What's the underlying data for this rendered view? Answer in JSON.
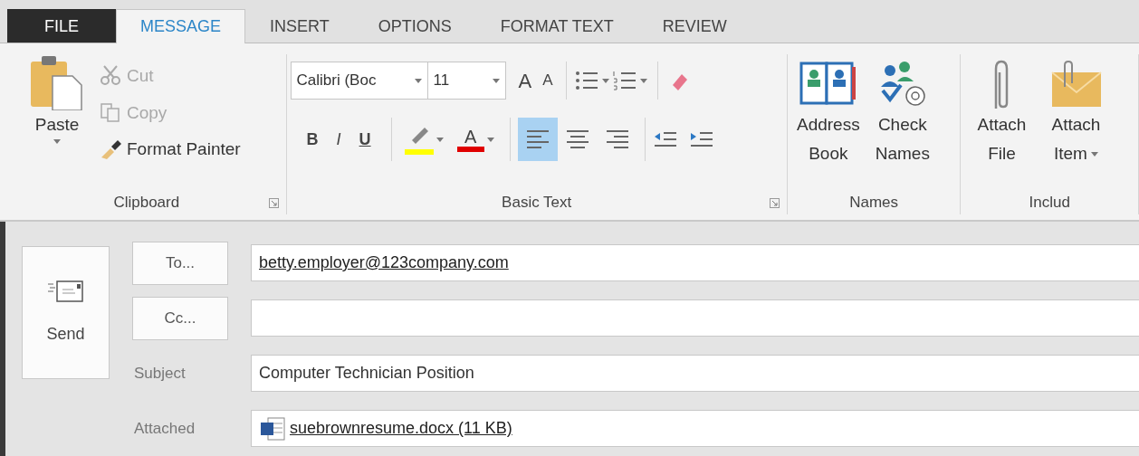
{
  "tabs": [
    {
      "label": "FILE",
      "kind": "file",
      "selected": false
    },
    {
      "label": "MESSAGE",
      "kind": "tab",
      "selected": true
    },
    {
      "label": "INSERT",
      "kind": "tab",
      "selected": false
    },
    {
      "label": "OPTIONS",
      "kind": "tab",
      "selected": false
    },
    {
      "label": "FORMAT TEXT",
      "kind": "tab",
      "selected": false
    },
    {
      "label": "REVIEW",
      "kind": "tab",
      "selected": false
    }
  ],
  "clipboard": {
    "label": "Clipboard",
    "launcher": true,
    "paste": "Paste",
    "items": [
      {
        "label": "Cut",
        "kind": "cut",
        "disabled": true
      },
      {
        "label": "Copy",
        "kind": "copy",
        "disabled": true
      },
      {
        "label": "Format Painter",
        "kind": "painter",
        "disabled": false
      }
    ]
  },
  "basic_text": {
    "label": "Basic Text",
    "launcher": true,
    "font": "Calibri (Boc",
    "size": "11",
    "grow": "A",
    "shrink": "A",
    "styles": [
      {
        "label": "B",
        "kind": "bold"
      },
      {
        "label": "I",
        "kind": "italic"
      },
      {
        "label": "U",
        "kind": "underline"
      }
    ],
    "font_color_label": "A",
    "alignment": [
      {
        "kind": "left",
        "selected": true
      },
      {
        "kind": "center",
        "selected": false
      },
      {
        "kind": "right",
        "selected": false
      }
    ]
  },
  "names": {
    "label": "Names",
    "buttons": [
      {
        "kind": "book",
        "lines": [
          "Address",
          "Book"
        ],
        "dropdown": false
      },
      {
        "kind": "check",
        "lines": [
          "Check",
          "Names"
        ],
        "dropdown": false
      }
    ]
  },
  "include": {
    "label": "Includ",
    "buttons": [
      {
        "kind": "clip",
        "lines": [
          "Attach",
          "File"
        ],
        "dropdown": false
      },
      {
        "kind": "item",
        "lines": [
          "Attach",
          "Item"
        ],
        "dropdown": true
      }
    ]
  },
  "compose": {
    "send": "Send",
    "fields": [
      {
        "kind": "button",
        "label": "To...",
        "value": "betty.employer@123company.com"
      },
      {
        "kind": "button",
        "label": "Cc..."
      },
      {
        "kind": "text",
        "label": "Subject",
        "value": "Computer Technician Position"
      },
      {
        "kind": "attachment",
        "label": "Attached",
        "value": "suebrownresume.docx (11 KB)"
      }
    ]
  }
}
